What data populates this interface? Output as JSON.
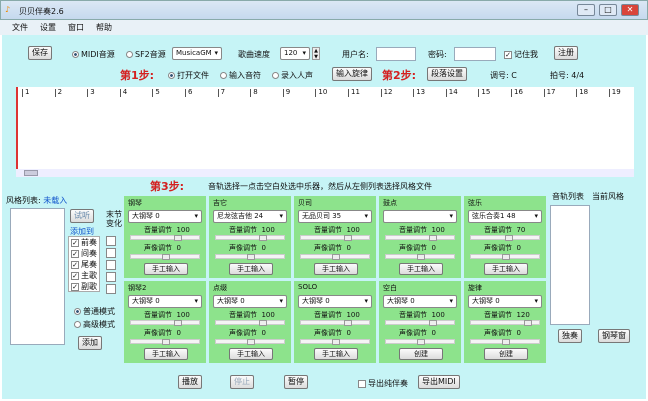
{
  "window": {
    "title": "贝贝伴奏2.6"
  },
  "menu": [
    "文件",
    "设置",
    "窗口",
    "帮助"
  ],
  "toolbar": {
    "save": "保存",
    "midi": "MIDI音源",
    "sf2": "SF2音源",
    "soundfont": "MusicaGM",
    "tempo_label": "歌曲速度",
    "tempo": "120",
    "user_label": "用户名:",
    "pass_label": "密码:",
    "remember": "记住我",
    "register": "注册"
  },
  "step1": {
    "label": "第1步:",
    "open": "打开文件",
    "input_notes": "输入音符",
    "record": "录入人声",
    "input_melody": "输入旋律"
  },
  "step2": {
    "label": "第2步:",
    "section": "段落设置",
    "key_label": "调号:",
    "key": "C",
    "beat_label": "拍号:",
    "beat": "4/4"
  },
  "ruler": [
    "1",
    "2",
    "3",
    "4",
    "5",
    "6",
    "7",
    "8",
    "9",
    "10",
    "11",
    "12",
    "13",
    "14",
    "15",
    "16",
    "17",
    "18",
    "19"
  ],
  "step3": {
    "label": "第3步:",
    "hint": "音轨选择一点击空白处选中乐器，然后从左侧列表选择风格文件"
  },
  "left": {
    "style_label": "风格列表:",
    "style_value": "未载入",
    "audition": "试听",
    "add_to": "添加到",
    "bar_change": "末节变化",
    "parts": [
      "前奏",
      "间奏",
      "尾奏",
      "主歌",
      "副歌"
    ],
    "normal": "普通模式",
    "advanced": "高级模式",
    "add": "添加"
  },
  "instruments": [
    {
      "name": "钢琴",
      "sel": "大钢琴 0",
      "vol": "100",
      "pan": "0",
      "btn": "手工输入",
      "vp": 0.7,
      "pp": 0.5
    },
    {
      "name": "吉它",
      "sel": "尼龙弦吉他 24",
      "vol": "100",
      "pan": "0",
      "btn": "手工输入",
      "vp": 0.7,
      "pp": 0.5
    },
    {
      "name": "贝司",
      "sel": "无品贝司 35",
      "vol": "100",
      "pan": "0",
      "btn": "手工输入",
      "vp": 0.7,
      "pp": 0.5
    },
    {
      "name": "鼓点",
      "sel": "",
      "vol": "100",
      "pan": "0",
      "btn": "手工输入",
      "vp": 0.7,
      "pp": 0.5
    },
    {
      "name": "弦乐",
      "sel": "弦乐合奏1 48",
      "vol": "70",
      "pan": "0",
      "btn": "手工输入",
      "vp": 0.55,
      "pp": 0.5
    },
    {
      "name": "钢琴2",
      "sel": "大钢琴 0",
      "vol": "100",
      "pan": "0",
      "btn": "手工输入",
      "vp": 0.7,
      "pp": 0.5
    },
    {
      "name": "点缀",
      "sel": "大钢琴 0",
      "vol": "100",
      "pan": "0",
      "btn": "手工输入",
      "vp": 0.7,
      "pp": 0.5
    },
    {
      "name": "SOLO",
      "sel": "大钢琴 0",
      "vol": "100",
      "pan": "0",
      "btn": "手工输入",
      "vp": 0.7,
      "pp": 0.5
    },
    {
      "name": "空白",
      "sel": "大钢琴 0",
      "vol": "100",
      "pan": "0",
      "btn": "创建",
      "vp": 0.7,
      "pp": 0.5
    },
    {
      "name": "旋律",
      "sel": "大钢琴 0",
      "vol": "120",
      "pan": "0",
      "btn": "创建",
      "vp": 0.85,
      "pp": 0.5
    }
  ],
  "vol_label": "音量调节",
  "pan_label": "声像调节",
  "right": {
    "track_list": "音轨列表",
    "current_style": "当前风格",
    "solo": "独奏",
    "piano_roll": "钢琴窗"
  },
  "bottom": {
    "play": "播放",
    "stop": "停止",
    "pause": "暂停",
    "export_pure": "导出纯伴奏",
    "export_midi": "导出MIDI"
  }
}
